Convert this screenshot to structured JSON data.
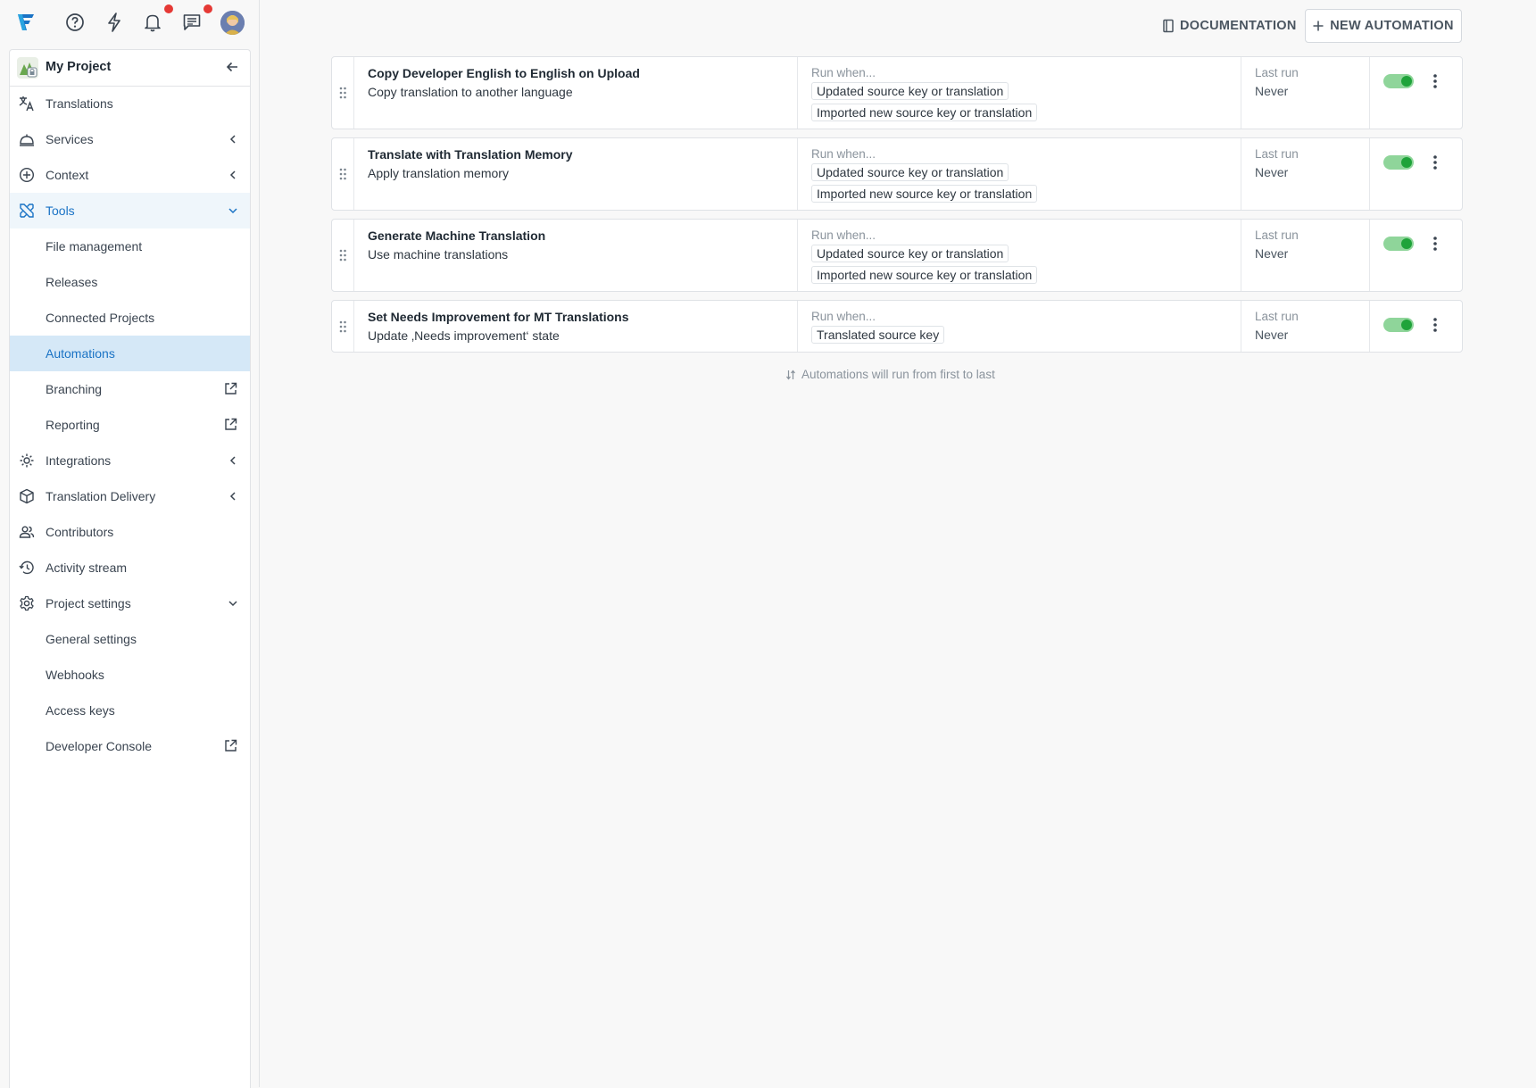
{
  "colors": {
    "accent": "#1a73c5",
    "active_bg": "#d5e8f7",
    "toggle_on": "#1fa33a",
    "badge": "#e53935"
  },
  "topbar": {
    "icons": [
      "logo-icon",
      "help-icon",
      "lightning-icon",
      "bell-icon",
      "chat-icon",
      "avatar"
    ]
  },
  "project": {
    "name": "My Project"
  },
  "sidebar": {
    "items": [
      {
        "label": "Translations",
        "icon": "translate-icon"
      },
      {
        "label": "Services",
        "icon": "services-icon"
      },
      {
        "label": "Context",
        "icon": "plus-circle-icon"
      },
      {
        "label": "Tools",
        "icon": "tools-icon"
      },
      {
        "label": "File management"
      },
      {
        "label": "Releases"
      },
      {
        "label": "Connected Projects"
      },
      {
        "label": "Automations"
      },
      {
        "label": "Branching"
      },
      {
        "label": "Reporting"
      },
      {
        "label": "Integrations",
        "icon": "integrations-icon"
      },
      {
        "label": "Translation Delivery",
        "icon": "delivery-icon"
      },
      {
        "label": "Contributors",
        "icon": "contributors-icon"
      },
      {
        "label": "Activity stream",
        "icon": "history-icon"
      },
      {
        "label": "Project settings",
        "icon": "gear-icon"
      },
      {
        "label": "General settings"
      },
      {
        "label": "Webhooks"
      },
      {
        "label": "Access keys"
      },
      {
        "label": "Developer Console"
      }
    ]
  },
  "toolbar": {
    "documentation_label": "DOCUMENTATION",
    "new_automation_label": "NEW AUTOMATION"
  },
  "automations": [
    {
      "title": "Copy Developer English to English on Upload",
      "description": "Copy translation to another language",
      "run_when_label": "Run when...",
      "triggers": [
        "Updated source key or translation",
        "Imported new source key or translation"
      ],
      "last_run_label": "Last run",
      "last_run": "Never",
      "enabled": true
    },
    {
      "title": "Translate with Translation Memory",
      "description": "Apply translation memory",
      "run_when_label": "Run when...",
      "triggers": [
        "Updated source key or translation",
        "Imported new source key or translation"
      ],
      "last_run_label": "Last run",
      "last_run": "Never",
      "enabled": true
    },
    {
      "title": "Generate Machine Translation",
      "description": "Use machine translations",
      "run_when_label": "Run when...",
      "triggers": [
        "Updated source key or translation",
        "Imported new source key or translation"
      ],
      "last_run_label": "Last run",
      "last_run": "Never",
      "enabled": true
    },
    {
      "title": "Set Needs Improvement for MT Translations",
      "description": "Update ‚Needs improvement‘ state",
      "run_when_label": "Run when...",
      "triggers": [
        "Translated source key"
      ],
      "last_run_label": "Last run",
      "last_run": "Never",
      "enabled": true
    }
  ],
  "footnote": "Automations will run from first to last"
}
